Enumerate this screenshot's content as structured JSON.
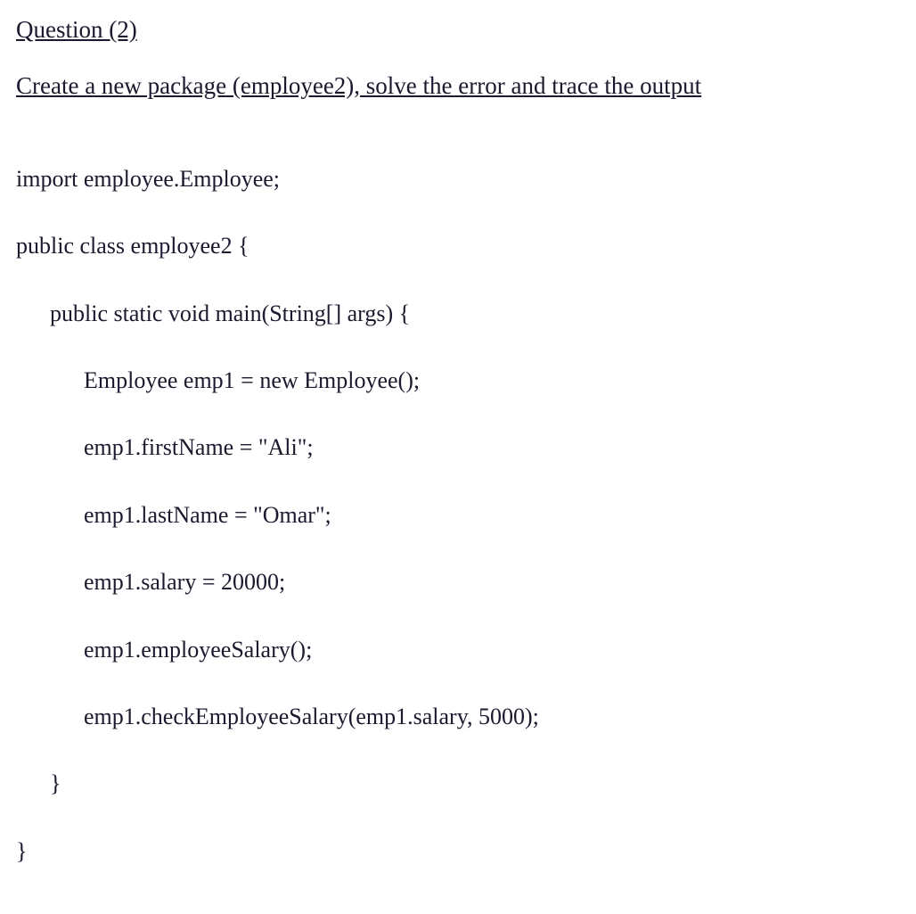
{
  "heading": "Question (2)",
  "subheading": "Create a new package (employee2), solve the error and trace the output",
  "code": {
    "line1": "import employee.Employee;",
    "line2": "public class employee2 {",
    "line3": "public static void main(String[] args) {",
    "line4": "Employee emp1 = new Employee();",
    "line5": "emp1.firstName = \"Ali\";",
    "line6": "emp1.lastName = \"Omar\";",
    "line7": "emp1.salary = 20000;",
    "line8": "emp1.employeeSalary();",
    "line9": "emp1.checkEmployeeSalary(emp1.salary, 5000);",
    "line10": "}",
    "line11": "}"
  }
}
